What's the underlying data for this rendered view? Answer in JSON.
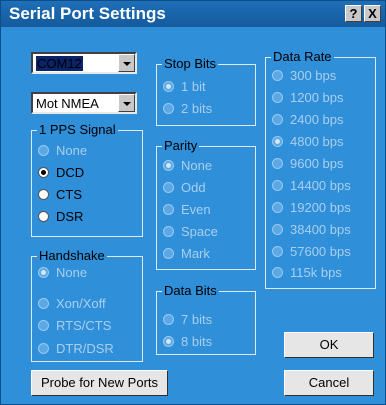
{
  "title": "Serial Port Settings",
  "title_buttons": {
    "help": "?",
    "close": "X"
  },
  "port_select": {
    "value": "COM12"
  },
  "protocol_select": {
    "value": "Mot NMEA"
  },
  "pps": {
    "label": "1 PPS Signal",
    "options": [
      "None",
      "DCD",
      "CTS",
      "DSR"
    ],
    "selected": "DCD"
  },
  "handshake": {
    "label": "Handshake",
    "options": [
      "None",
      "Xon/Xoff",
      "RTS/CTS",
      "DTR/DSR"
    ],
    "selected": "None"
  },
  "stop_bits": {
    "label": "Stop Bits",
    "options": [
      "1 bit",
      "2 bits"
    ],
    "selected": "1 bit"
  },
  "parity": {
    "label": "Parity",
    "options": [
      "None",
      "Odd",
      "Even",
      "Space",
      "Mark"
    ],
    "selected": "None"
  },
  "data_bits": {
    "label": "Data Bits",
    "options": [
      "7 bits",
      "8 bits"
    ],
    "selected": "8 bits"
  },
  "data_rate": {
    "label": "Data Rate",
    "options": [
      "300 bps",
      "1200 bps",
      "2400 bps",
      "4800 bps",
      "9600 bps",
      "14400 bps",
      "19200 bps",
      "38400 bps",
      "57600 bps",
      "115k bps"
    ],
    "selected": "4800 bps"
  },
  "buttons": {
    "probe": "Probe for New Ports",
    "ok": "OK",
    "cancel": "Cancel"
  },
  "colors": {
    "dialog": "#2f8fd9",
    "titlebar": "#1a66ae",
    "disabled_text": "#a9cfee"
  }
}
